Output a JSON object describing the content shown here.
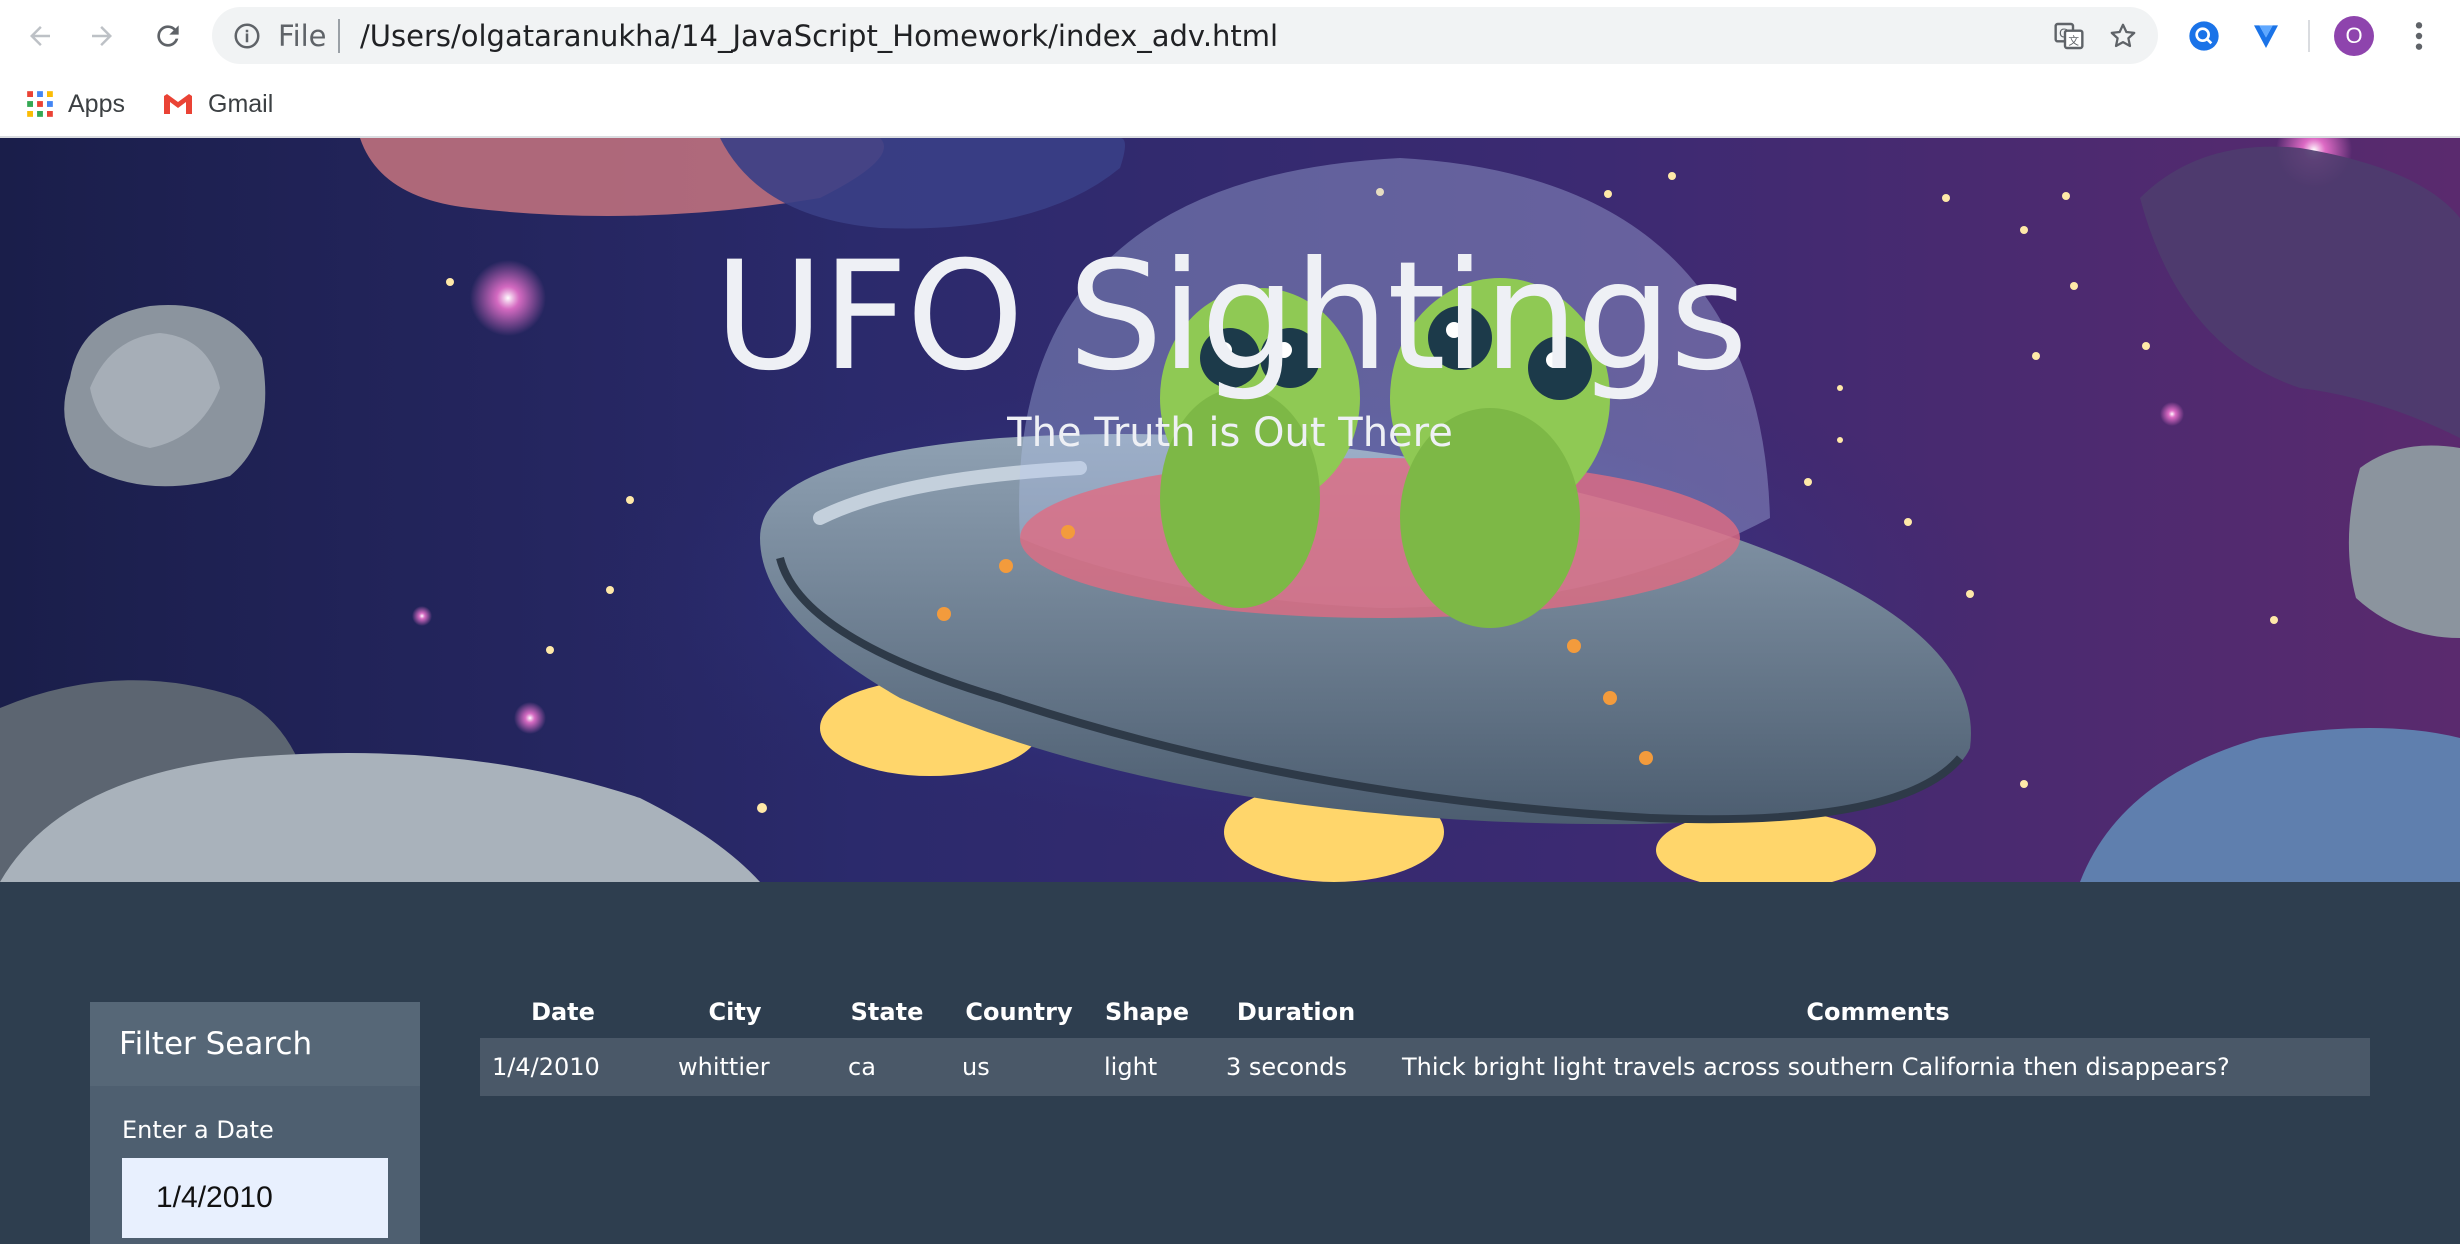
{
  "browser": {
    "scheme_label": "File",
    "url": "/Users/olgataranukha/14_JavaScript_Homework/index_adv.html",
    "profile_initial": "O",
    "bookmarks": [
      {
        "label": "Apps",
        "icon": "apps-grid-icon"
      },
      {
        "label": "Gmail",
        "icon": "gmail-icon"
      }
    ]
  },
  "hero": {
    "title": "UFO Sightings",
    "subtitle": "The Truth is Out There"
  },
  "filter": {
    "title": "Filter Search",
    "date_label": "Enter a Date",
    "date_value": "1/4/2010"
  },
  "table": {
    "headers": [
      "Date",
      "City",
      "State",
      "Country",
      "Shape",
      "Duration",
      "Comments"
    ],
    "rows": [
      [
        "1/4/2010",
        "whittier",
        "ca",
        "us",
        "light",
        "3 seconds",
        "Thick bright light travels across southern California then disappears?"
      ]
    ]
  },
  "colors": {
    "page_background": "#2e3e4f",
    "panel_background": "#4e5f70",
    "row_background": "#4a5868",
    "input_background": "#e8f0fe",
    "avatar": "#8e44ad"
  }
}
